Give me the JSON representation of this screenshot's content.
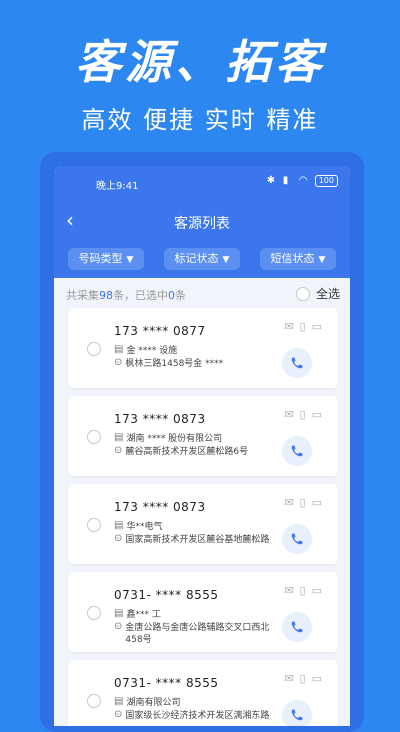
{
  "hero": {
    "title": "客源、拓客",
    "subtitle": "高效 便捷 实时 精准"
  },
  "status_bar": {
    "time": "晚上9:41",
    "battery": "100"
  },
  "nav": {
    "back": "‹",
    "title": "客源列表"
  },
  "filters": [
    {
      "label": "号码类型"
    },
    {
      "label": "标记状态"
    },
    {
      "label": "短信状态"
    }
  ],
  "summary": {
    "prefix": "共采集",
    "count": "98",
    "middle": "条，已选中",
    "selected": "0",
    "suffix": "条",
    "select_all": "全选"
  },
  "records": [
    {
      "phone": "173 **** 0877",
      "company": "金 ****  设施",
      "address": "枫林三路1458号金 ****"
    },
    {
      "phone": "173 **** 0873",
      "company": "湖南 **** 股份有限公司",
      "address": "麓谷高新技术开发区麓松路6号"
    },
    {
      "phone": "173 **** 0873",
      "company": "华**电气",
      "address": "国家高新技术开发区麓谷基地麓松路"
    },
    {
      "phone": "0731- **** 8555",
      "company": "鑫*** 工",
      "address": "金唐公路与金唐公路辅路交叉口西北458号"
    },
    {
      "phone": "0731- **** 8555",
      "company": "湖南有限公司",
      "address": "国家级长沙经济技术开发区漓湘东路"
    }
  ],
  "icons": {
    "message": "envelope-icon",
    "note": "note-icon",
    "phone_device": "mobile-icon",
    "call": "phone-icon",
    "company": "building-icon",
    "address": "location-pin-icon"
  },
  "colors": {
    "background": "#2d87f0",
    "header": "#3b76ec",
    "accent": "#3b76ec"
  }
}
